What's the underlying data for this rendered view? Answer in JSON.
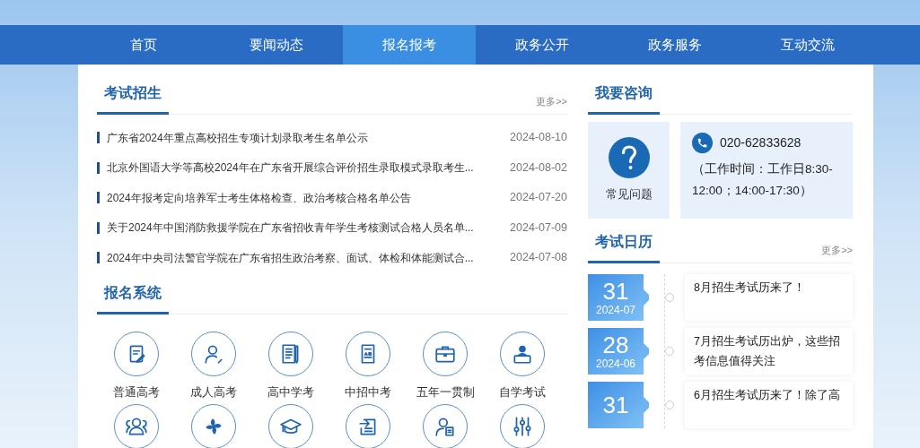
{
  "nav": [
    {
      "label": "首页",
      "selected": false
    },
    {
      "label": "要闻动态",
      "selected": false
    },
    {
      "label": "报名报考",
      "selected": true
    },
    {
      "label": "政务公开",
      "selected": false
    },
    {
      "label": "政务服务",
      "selected": false
    },
    {
      "label": "互动交流",
      "selected": false
    }
  ],
  "exam_news": {
    "title": "考试招生",
    "more": "更多>>",
    "items": [
      {
        "title": "广东省2024年重点高校招生专项计划录取考生名单公示",
        "date": "2024-08-10"
      },
      {
        "title": "北京外国语大学等高校2024年在广东省开展综合评价招生录取模式录取考生...",
        "date": "2024-08-02"
      },
      {
        "title": "2024年报考定向培养军士考生体格检查、政治考核合格名单公告",
        "date": "2024-07-20"
      },
      {
        "title": "关于2024年中国消防救援学院在广东省招收青年学生考核测试合格人员名单...",
        "date": "2024-07-09"
      },
      {
        "title": "2024年中央司法警官学院在广东省招生政治考察、面试、体检和体能测试合...",
        "date": "2024-07-08"
      }
    ]
  },
  "registration": {
    "title": "报名系统",
    "items": [
      {
        "kind": "doc-pen",
        "label": "普通高考"
      },
      {
        "kind": "person-pen",
        "label": "成人高考"
      },
      {
        "kind": "notebook",
        "label": "高中学考"
      },
      {
        "kind": "score-sheet",
        "label": "中招中考"
      },
      {
        "kind": "briefcase",
        "label": "五年一贯制"
      },
      {
        "kind": "laptop-person",
        "label": "自学考试"
      },
      {
        "kind": "group"
      },
      {
        "kind": "flower"
      },
      {
        "kind": "grad-cap"
      },
      {
        "kind": "transfer"
      },
      {
        "kind": "person-doc"
      },
      {
        "kind": "sliders"
      }
    ]
  },
  "consult": {
    "title": "我要咨询",
    "faq": "常见问题",
    "phone": "020-62833628",
    "hours": "（工作时间：工作日8:30-12:00；14:00-17:30）"
  },
  "calendar": {
    "title": "考试日历",
    "more": "更多>>",
    "items": [
      {
        "day": "31",
        "month": "2024-07",
        "text": "8月招生考试历来了！"
      },
      {
        "day": "28",
        "month": "2024-06",
        "text": "7月招生考试历出炉，这些招考信息值得关注"
      },
      {
        "day": "31",
        "text": "6月招生考试历来了！除了高"
      }
    ]
  }
}
